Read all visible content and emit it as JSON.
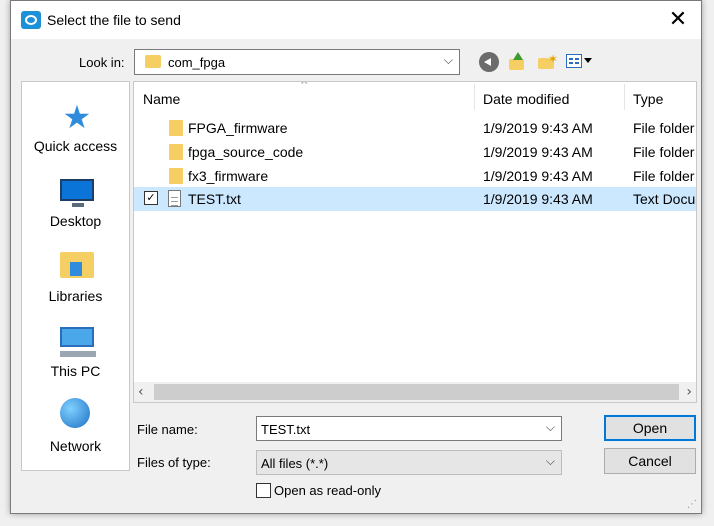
{
  "dialog": {
    "title": "Select the file to send",
    "close_glyph": "✕"
  },
  "toolbar": {
    "look_in_label": "Look in:",
    "look_in_value": "com_fpga",
    "icons": [
      "back-icon",
      "up-folder-icon",
      "new-folder-icon",
      "view-menu-icon"
    ]
  },
  "places": [
    {
      "label": "Quick access",
      "icon": "quick-access-icon"
    },
    {
      "label": "Desktop",
      "icon": "desktop-icon"
    },
    {
      "label": "Libraries",
      "icon": "libraries-icon"
    },
    {
      "label": "This PC",
      "icon": "this-pc-icon"
    },
    {
      "label": "Network",
      "icon": "network-icon"
    }
  ],
  "file_list": {
    "columns": {
      "name": "Name",
      "date": "Date modified",
      "type": "Type"
    },
    "rows": [
      {
        "name": "FPGA_firmware",
        "date": "1/9/2019 9:43 AM",
        "type": "File folder"
      },
      {
        "name": "fpga_source_code",
        "date": "1/9/2019 9:43 AM",
        "type": "File folder"
      },
      {
        "name": "fx3_firmware",
        "date": "1/9/2019 9:43 AM",
        "type": "File folder"
      },
      {
        "name": "TEST.txt",
        "date": "1/9/2019 9:43 AM",
        "type": "Text Docu",
        "selected": true
      }
    ],
    "scroll_left": "‹",
    "scroll_right": "›"
  },
  "form": {
    "file_name_label": "File name:",
    "file_name_value": "TEST.txt",
    "file_type_label": "Files of type:",
    "file_type_value": "All files (*.*)",
    "open_readonly_label": "Open as read-only",
    "open_button": "Open",
    "cancel_button": "Cancel"
  },
  "colors": {
    "selection": "#cce8ff",
    "accent": "#0078d7"
  }
}
